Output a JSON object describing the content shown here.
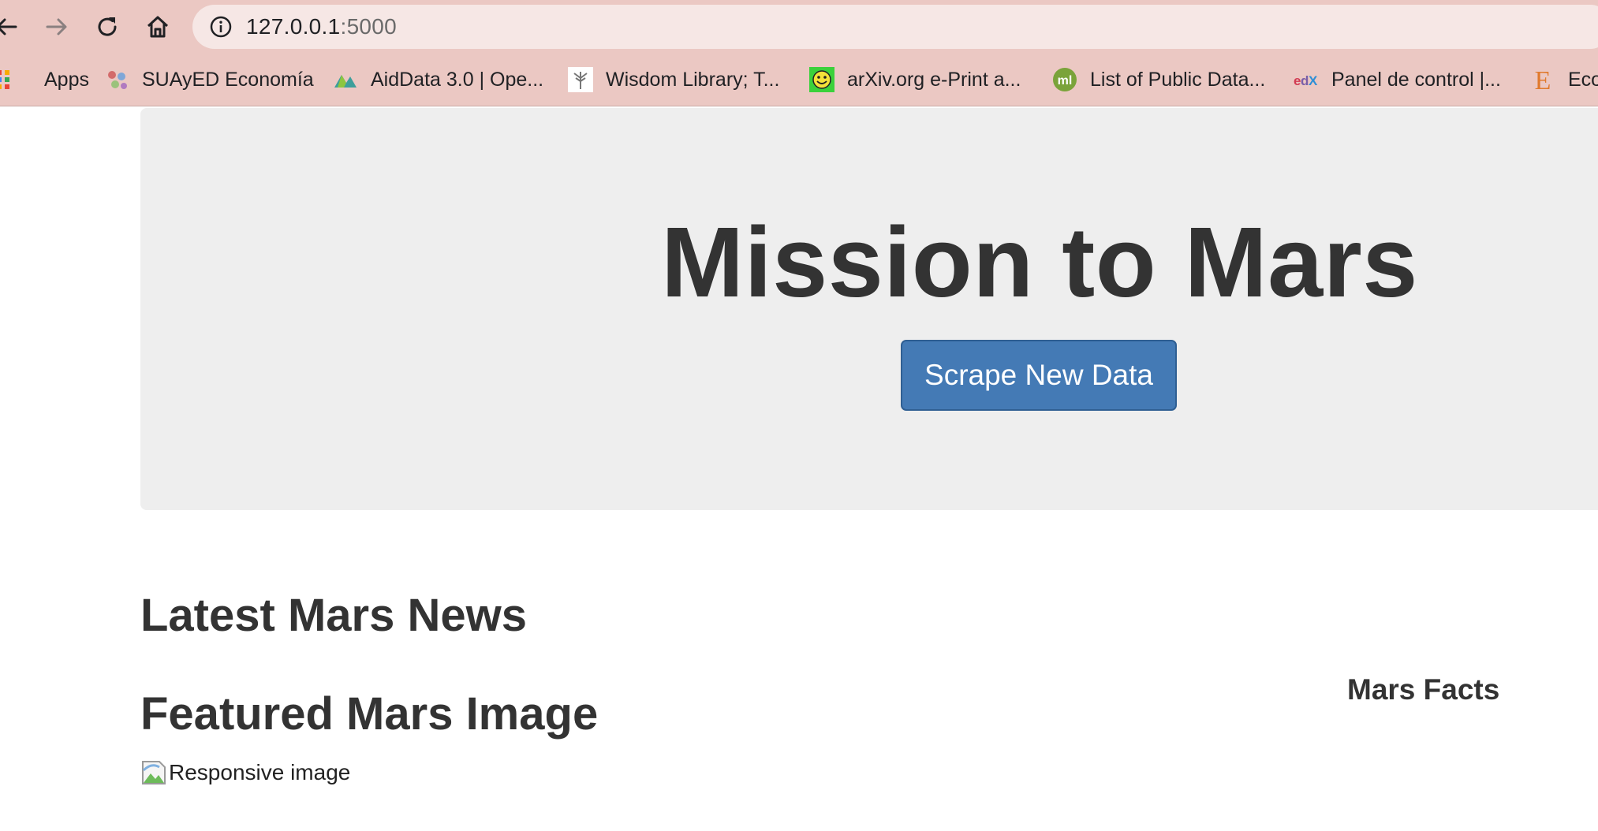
{
  "browser": {
    "url_host": "127.0.0.1",
    "url_port": ":5000",
    "bookmarks": [
      {
        "label": "Apps",
        "icon": "apps-grid-icon"
      },
      {
        "label": "SUAyED Economía",
        "icon": "suayed-icon"
      },
      {
        "label": "AidData 3.0 | Ope...",
        "icon": "aiddata-icon"
      },
      {
        "label": "Wisdom Library; T...",
        "icon": "wisdom-library-icon"
      },
      {
        "label": "arXiv.org e-Print a...",
        "icon": "arxiv-icon"
      },
      {
        "label": "List of Public Data...",
        "icon": "ml-icon"
      },
      {
        "label": "Panel de control |...",
        "icon": "edx-icon"
      },
      {
        "label": "Eco",
        "icon": "eco-icon"
      }
    ]
  },
  "page": {
    "title": "Mission to Mars",
    "scrape_button": "Scrape New Data",
    "news_heading": "Latest Mars News",
    "image_heading": "Featured Mars Image",
    "image_alt": "Responsive image",
    "facts_heading": "Mars Facts"
  },
  "colors": {
    "chrome": "#ebc8c3",
    "jumbotron": "#eeeeee",
    "button": "#447ab5"
  }
}
